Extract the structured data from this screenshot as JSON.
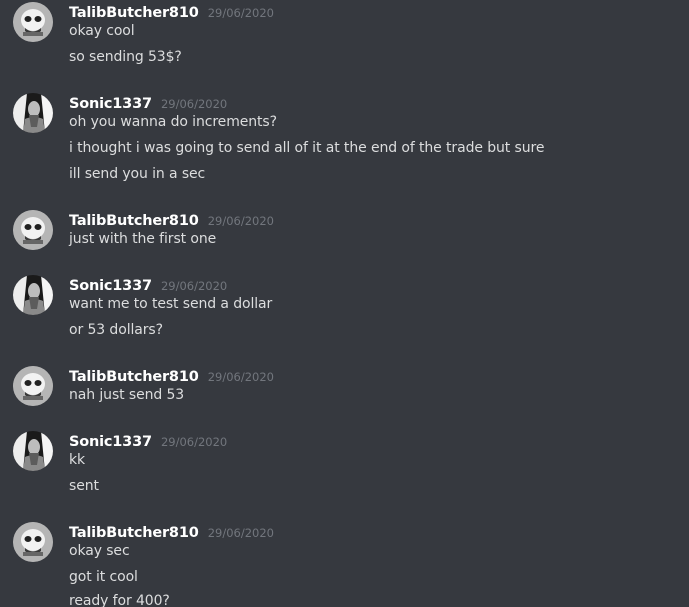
{
  "messages": [
    {
      "author": "TalibButcher810",
      "timestamp": "29/06/2020",
      "avatar_icon": "skull-mask-avatar",
      "lines": [
        "okay cool",
        "so sending 53$?"
      ]
    },
    {
      "author": "Sonic1337",
      "timestamp": "29/06/2020",
      "avatar_icon": "grayscale-person-avatar",
      "lines": [
        "oh you wanna do increments?",
        "i thought i was going to send all of it at the end of the trade but sure",
        "ill send you in a sec"
      ]
    },
    {
      "author": "TalibButcher810",
      "timestamp": "29/06/2020",
      "avatar_icon": "skull-mask-avatar",
      "lines": [
        "just with the first one"
      ]
    },
    {
      "author": "Sonic1337",
      "timestamp": "29/06/2020",
      "avatar_icon": "grayscale-person-avatar",
      "lines": [
        "want me to test send a dollar",
        "or 53 dollars?"
      ]
    },
    {
      "author": "TalibButcher810",
      "timestamp": "29/06/2020",
      "avatar_icon": "skull-mask-avatar",
      "lines": [
        "nah just send 53"
      ]
    },
    {
      "author": "Sonic1337",
      "timestamp": "29/06/2020",
      "avatar_icon": "grayscale-person-avatar",
      "lines": [
        "kk",
        "sent"
      ]
    },
    {
      "author": "TalibButcher810",
      "timestamp": "29/06/2020",
      "avatar_icon": "skull-mask-avatar",
      "lines": [
        "okay sec",
        "got it cool",
        "ready for 400?"
      ]
    }
  ],
  "colors": {
    "background": "#36393f",
    "username": "#ffffff",
    "timestamp": "#72767d",
    "message_text": "#dcddde"
  }
}
